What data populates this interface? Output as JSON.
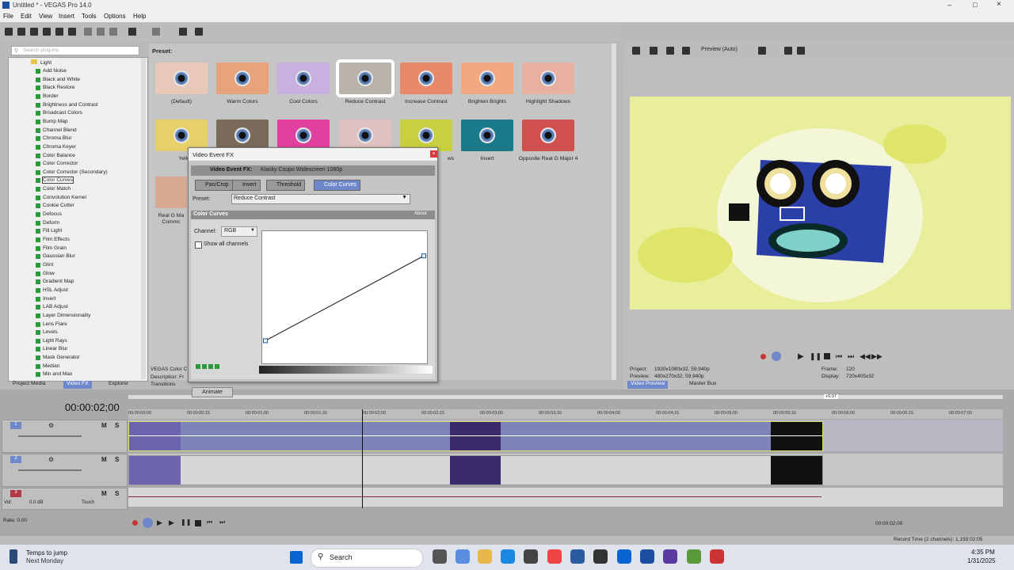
{
  "window": {
    "title": "Untitled * - VEGAS Pro 14.0"
  },
  "menu": [
    "File",
    "Edit",
    "View",
    "Insert",
    "Tools",
    "Options",
    "Help"
  ],
  "search": {
    "placeholder": "Search plug-ins"
  },
  "tree": {
    "root": "Light",
    "items": [
      "Add Noise",
      "Black and White",
      "Black Restore",
      "Border",
      "Brightness and Contrast",
      "Broadcast Colors",
      "Bump Map",
      "Channel Blend",
      "Chroma Blur",
      "Chroma Keyer",
      "Color Balance",
      "Color Corrector",
      "Color Corrector (Secondary)",
      "Color Curves",
      "Color Match",
      "Convolution Kernel",
      "Cookie Cutter",
      "Defocus",
      "Deform",
      "Fill Light",
      "Film Effects",
      "Film Grain",
      "Gaussian Blur",
      "Glint",
      "Glow",
      "Gradient Map",
      "HSL Adjust",
      "Invert",
      "LAB Adjust",
      "Layer Dimensionality",
      "Lens Flare",
      "Levels",
      "Light Rays",
      "Linear Blur",
      "Mask Generator",
      "Median",
      "Min and Max"
    ],
    "selected_index": 13
  },
  "preset_label": "Preset:",
  "presets_row1": [
    "(Default)",
    "Warm Colors",
    "Cool Colors",
    "Reduce Contrast",
    "Increase Contrast",
    "Brighten Brights",
    "Highlight Shadows"
  ],
  "presets_row2_visible": [
    "Yellow T",
    "ws",
    "Invert",
    "Opposite Real G Major 4"
  ],
  "presets_row3_visible": [
    "Real G Ma",
    "Commc"
  ],
  "plugin_info": [
    "VEGAS Color C",
    "Description: Fr"
  ],
  "transitions_tab": "Transitions",
  "dialog": {
    "title": "Video Event FX",
    "header_label": "Video Event FX:",
    "header_value": "Klasky Csupo Widescreen 1080p",
    "chain": [
      "Pan/Crop",
      "Invert",
      "Threshold",
      "Color Curves"
    ],
    "preset_label": "Preset:",
    "preset_value": "Reduce Contrast",
    "section": "Color Curves",
    "about": "About",
    "channel_label": "Channel:",
    "channel_value": "RGB",
    "show_all": "Show all channels",
    "animate": "Animate"
  },
  "curve": {
    "points": [
      [
        0,
        0.16
      ],
      [
        1,
        0.83
      ]
    ]
  },
  "tabs": [
    "Project Media",
    "Video FX",
    "Explorer"
  ],
  "preview": {
    "mode": "Preview (Auto)",
    "project_label": "Project:",
    "project_value": "1920x1080x32, 59.940p",
    "preview_label": "Preview:",
    "preview_value": "480x270x32, 59.940p",
    "frame_label": "Frame:",
    "frame_value": "120",
    "display_label": "Display:",
    "display_value": "720x405x32",
    "tabs": [
      "Video Preview",
      "Master Bus"
    ]
  },
  "timeline": {
    "timecode": "00:00:02;00",
    "end_marker": "+5:37",
    "ruler": [
      "00:00:00;00",
      "00:00:00;15",
      "00:00:01;00",
      "00:00:01;15",
      "00:00:02;00",
      "00:00:02;15",
      "00:00:03;00",
      "00:00:03;15",
      "00:00:04;00",
      "00:00:04;15",
      "00:00:05;00",
      "00:00:05;15",
      "00:00:06;00",
      "00:00:06;15",
      "00:00:07;00"
    ],
    "tracks": [
      "1",
      "2",
      "3"
    ],
    "audio_vol": "0.0 dB",
    "audio_label": "Vol:",
    "touch": "Touch",
    "rate": "Rate: 0.00",
    "end_time": "00:00:02;00",
    "record_time": "Record Time (2 channels): 1,193:02:05"
  },
  "taskbar": {
    "weather1": "Temps to jump",
    "weather2": "Next Monday",
    "search": "Search",
    "time": "4:35 PM",
    "date": "1/31/2025"
  },
  "colors": {
    "accent": "#6e88c9",
    "video_bg": "#e8ee9a"
  }
}
